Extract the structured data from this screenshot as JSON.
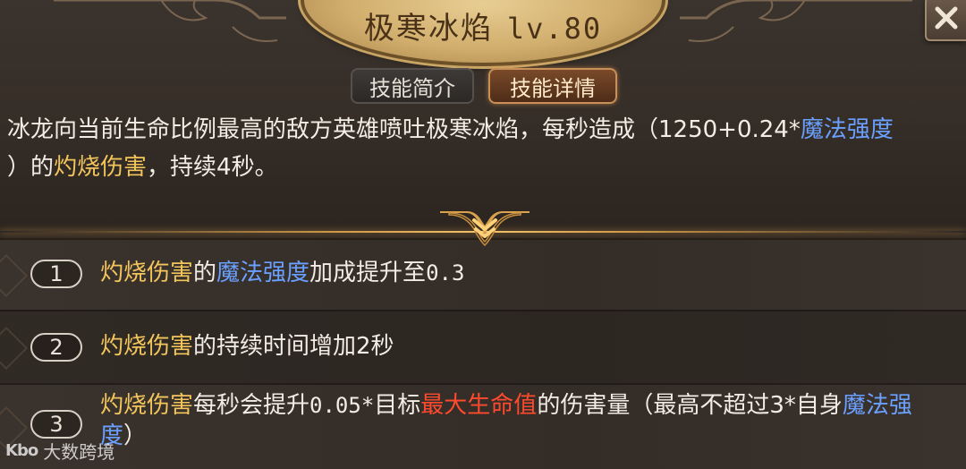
{
  "skill": {
    "name": "极寒冰焰",
    "level": "lv.80"
  },
  "tabs": [
    {
      "label": "技能简介",
      "active": false
    },
    {
      "label": "技能详情",
      "active": true
    }
  ],
  "description": {
    "p1": "冰龙向当前生命比例最高的敌方英雄喷吐极寒冰焰，每秒造成（1250+0.24*",
    "p2": "魔法强度",
    "p3": "）的",
    "p4": "灼烧伤害",
    "p5": "，持续4秒。"
  },
  "upgrades": [
    {
      "number": "1",
      "a": "灼烧伤害",
      "b": "的",
      "c": "魔法强度",
      "d": "加成提升至",
      "e": "0.3"
    },
    {
      "number": "2",
      "a": "灼烧伤害",
      "b": "的持续时间增加2秒"
    },
    {
      "number": "3",
      "a": "灼烧伤害",
      "b": "每秒会提升",
      "c": "0.05*",
      "d": "目标",
      "e": "最大生命值",
      "f": "的伤害量（最高不超过3*自身",
      "g": "魔法强度",
      "h": "）"
    }
  ],
  "watermark": {
    "logo": "Kbo",
    "text": "大数跨境"
  },
  "colors": {
    "gold_text": "#f2c45c",
    "blue_text": "#6aa0ff",
    "red_text": "#ff4a2e",
    "active_tab_border": "#c89058"
  },
  "icons": {
    "close": "close-icon",
    "chevron": "double-chevron-down-icon"
  }
}
